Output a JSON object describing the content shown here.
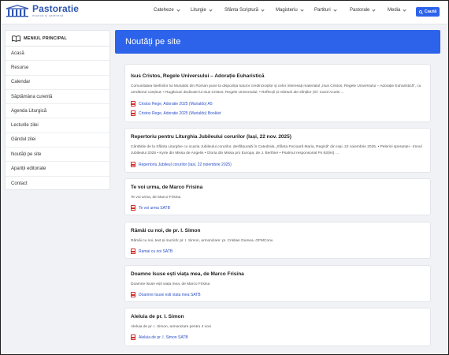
{
  "brand": {
    "title": "Pastoratie",
    "subtitle": "muzică și cateheză"
  },
  "nav": {
    "items": [
      "Cateheze",
      "Liturgie",
      "Sfânta Scriptură",
      "Magisteriu",
      "Partituri",
      "Pastorale",
      "Media"
    ],
    "search_label": "Caută"
  },
  "sidebar": {
    "title": "MENIUL PRINCIPAL",
    "items": [
      "Acasă",
      "Resurse",
      "Calendar",
      "Săptămâna curentă",
      "Agenda Liturgică",
      "Lecturile zilei",
      "Gândul zilei",
      "Noutăți pe site",
      "Apariții editoriale",
      "Contact"
    ]
  },
  "page": {
    "title": "Noutăți pe site"
  },
  "cards": [
    {
      "title": "Isus Cristos, Regele Universului – Adorație Euharistică",
      "desc": "Comunitatea loiefinilor lui Murialdo din Roman pune la dispoziția tuturor credincioșilor și celor interesați materialul „Isus Cristos, Regele Universului – Adorație Euharistică”, cu următorul conținut: • Rugăciuni dedicate lui Isus Cristos, Regele Universului; • Reflecții și mărturii ale sfinților (Sf. Carol Acutis …",
      "attachments": [
        "Cristos Rege, Adoratie 2025 (Murialdo) A5",
        "Cristos Rege, Adoratie 2025 (Murialdo) Booklet"
      ]
    },
    {
      "title": "Repertoriu pentru Liturghia Jubileului corurilor (Iași, 22 nov. 2025)",
      "desc": "Cântările de la Sfânta Liturghie cu ocazia Jubileului corurilor, desfășurată în Catedrala „Sfânta Fecioară Maria, Regină” din Iași, 22 noiembrie 2025. • Pelerini speranței - Imnul Jubileului 2025 • Kyrie din Missa de Angelis • Gloria din Missa pro Europa, de J. Berthier • Psalmul responsorial Ps 93(94) …",
      "attachments": [
        "Repertoriu Jubileul corurilor (Iasi, 22 noiembrie 2025)"
      ]
    },
    {
      "title": "Te voi urma, de Marco Frisina",
      "desc": "Te voi urma, de Marco Frisina",
      "attachments": [
        "Te voi urma SATB"
      ]
    },
    {
      "title": "Rămâi cu noi, de pr. I. Simon",
      "desc": "Rămâi cu noi, text și muzică: pr. I. Simon, armonizare: pr. Cristian Dumea, OFMConv.",
      "attachments": [
        "Ramai cu noi SATB"
      ]
    },
    {
      "title": "Doamne Isuse ești viața mea, de Marco Frisina",
      "desc": "Doamne Isuse ești viața mea, de Marco Frisina",
      "attachments": [
        "Doamne Isuse esti viata mea SATB"
      ]
    },
    {
      "title": "Aleluia de pr. I. Simon",
      "desc": "Aleluia de pr. I. Simon, armonizare pentru 4 voci",
      "attachments": [
        "Aleluia de pr. I. Simon SATB"
      ]
    }
  ],
  "colors": {
    "accent": "#2c63ea",
    "brand": "#2f56b0",
    "link": "#2c4fc4",
    "pdf": "#d93025"
  },
  "icons": {
    "logo": "church-columns-icon",
    "sidebar": "book-icon",
    "search": "search-icon",
    "attachment": "pdf-file-icon",
    "dropdown": "chevron-down-icon"
  }
}
